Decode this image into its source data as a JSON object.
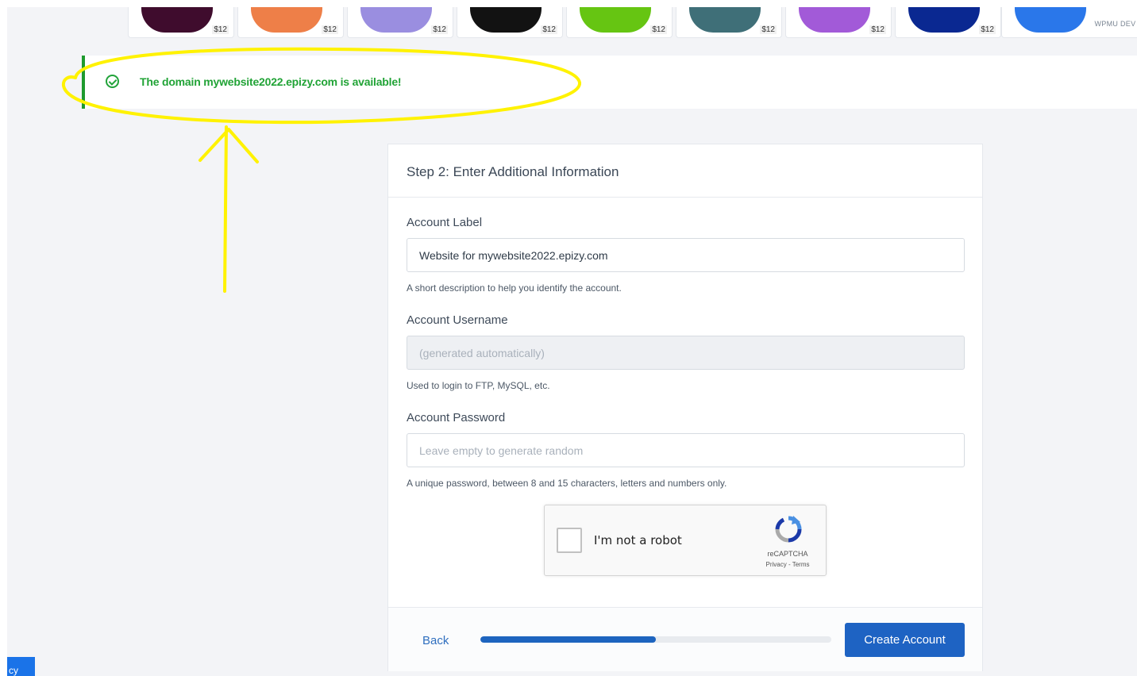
{
  "theme_row": {
    "cards": [
      {
        "price": "$12",
        "color": "#3f0c2d"
      },
      {
        "price": "$12",
        "color": "#ee7f48"
      },
      {
        "price": "$12",
        "color": "#9a8ee0"
      },
      {
        "price": "$12",
        "color": "#121212"
      },
      {
        "price": "$12",
        "color": "#66c512"
      },
      {
        "price": "$12",
        "color": "#3f6f78"
      },
      {
        "price": "$12",
        "color": "#a25ad8"
      },
      {
        "price": "$12",
        "color": "#0a2891"
      },
      {
        "price": "",
        "color": "#2a77ea",
        "name": "WPMU DEV I"
      }
    ]
  },
  "alert": {
    "message": "The domain mywebsite2022.epizy.com is available!",
    "icon": "check-circle-icon",
    "color": "#21a336"
  },
  "form": {
    "title": "Step 2: Enter Additional Information",
    "account_label": {
      "label": "Account Label",
      "value": "Website for mywebsite2022.epizy.com",
      "help": "A short description to help you identify the account."
    },
    "account_username": {
      "label": "Account Username",
      "placeholder": "(generated automatically)",
      "help": "Used to login to FTP, MySQL, etc."
    },
    "account_password": {
      "label": "Account Password",
      "placeholder": "Leave empty to generate random",
      "help": "A unique password, between 8 and 15 characters, letters and numbers only."
    },
    "recaptcha": {
      "label": "I'm not a robot",
      "brand": "reCAPTCHA",
      "links": "Privacy - Terms"
    },
    "footer": {
      "back_label": "Back",
      "progress_fraction": 0.5,
      "create_label": "Create Account"
    }
  },
  "privacy_tab": {
    "label": "cy"
  },
  "annotation": {
    "color": "#fff200"
  }
}
